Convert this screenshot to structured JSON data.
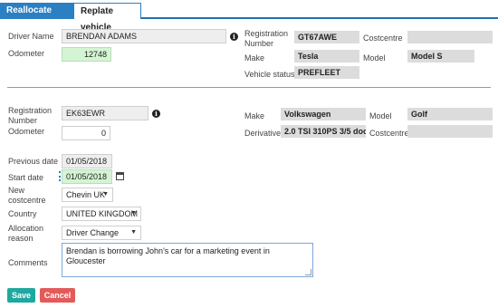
{
  "tabs": [
    "Reallocate driver",
    "Replate vehicle"
  ],
  "driver": {
    "name_label": "Driver Name",
    "name_value": "BRENDAN ADAMS",
    "odometer_label": "Odometer",
    "odometer_value": "12748"
  },
  "current_vehicle": {
    "reg_label": "Registration Number",
    "reg_value": "GT67AWE",
    "costcentre_label": "Costcentre",
    "costcentre_value": "",
    "make_label": "Make",
    "make_value": "Tesla",
    "model_label": "Model",
    "model_value": "Model S",
    "status_label": "Vehicle status",
    "status_value": "PREFLEET"
  },
  "new_vehicle": {
    "reg_label": "Registration Number",
    "reg_value": "EK63EWR",
    "odometer_label": "Odometer",
    "odometer_value": "0",
    "make_label": "Make",
    "make_value": "Volkswagen",
    "model_label": "Model",
    "model_value": "Golf",
    "derivative_label": "Derivative",
    "derivative_value": "2.0 TSI 310PS 3/5 door 4M",
    "costcentre_label": "Costcentre",
    "costcentre_value": ""
  },
  "allocation": {
    "prev_date_label": "Previous date",
    "prev_date_value": "01/05/2018",
    "start_date_label": "Start date",
    "start_date_value": "01/05/2018",
    "new_costcentre_label": "New costcentre",
    "new_costcentre_value": "Chevin UK",
    "country_label": "Country",
    "country_value": "UNITED KINGDOM",
    "reason_label": "Allocation reason",
    "reason_value": "Driver Change",
    "comments_label": "Comments",
    "comments_value": "Brendan is borrowing John's car for a marketing event in Gloucester"
  },
  "buttons": {
    "save": "Save",
    "cancel": "Cancel"
  },
  "colors": {
    "tab_active": "#2b80c4",
    "save": "#1fa8a0",
    "cancel": "#e45a5a",
    "highlight": "#d4f5d4"
  },
  "icons": [
    "info-icon",
    "calendar-icon"
  ]
}
